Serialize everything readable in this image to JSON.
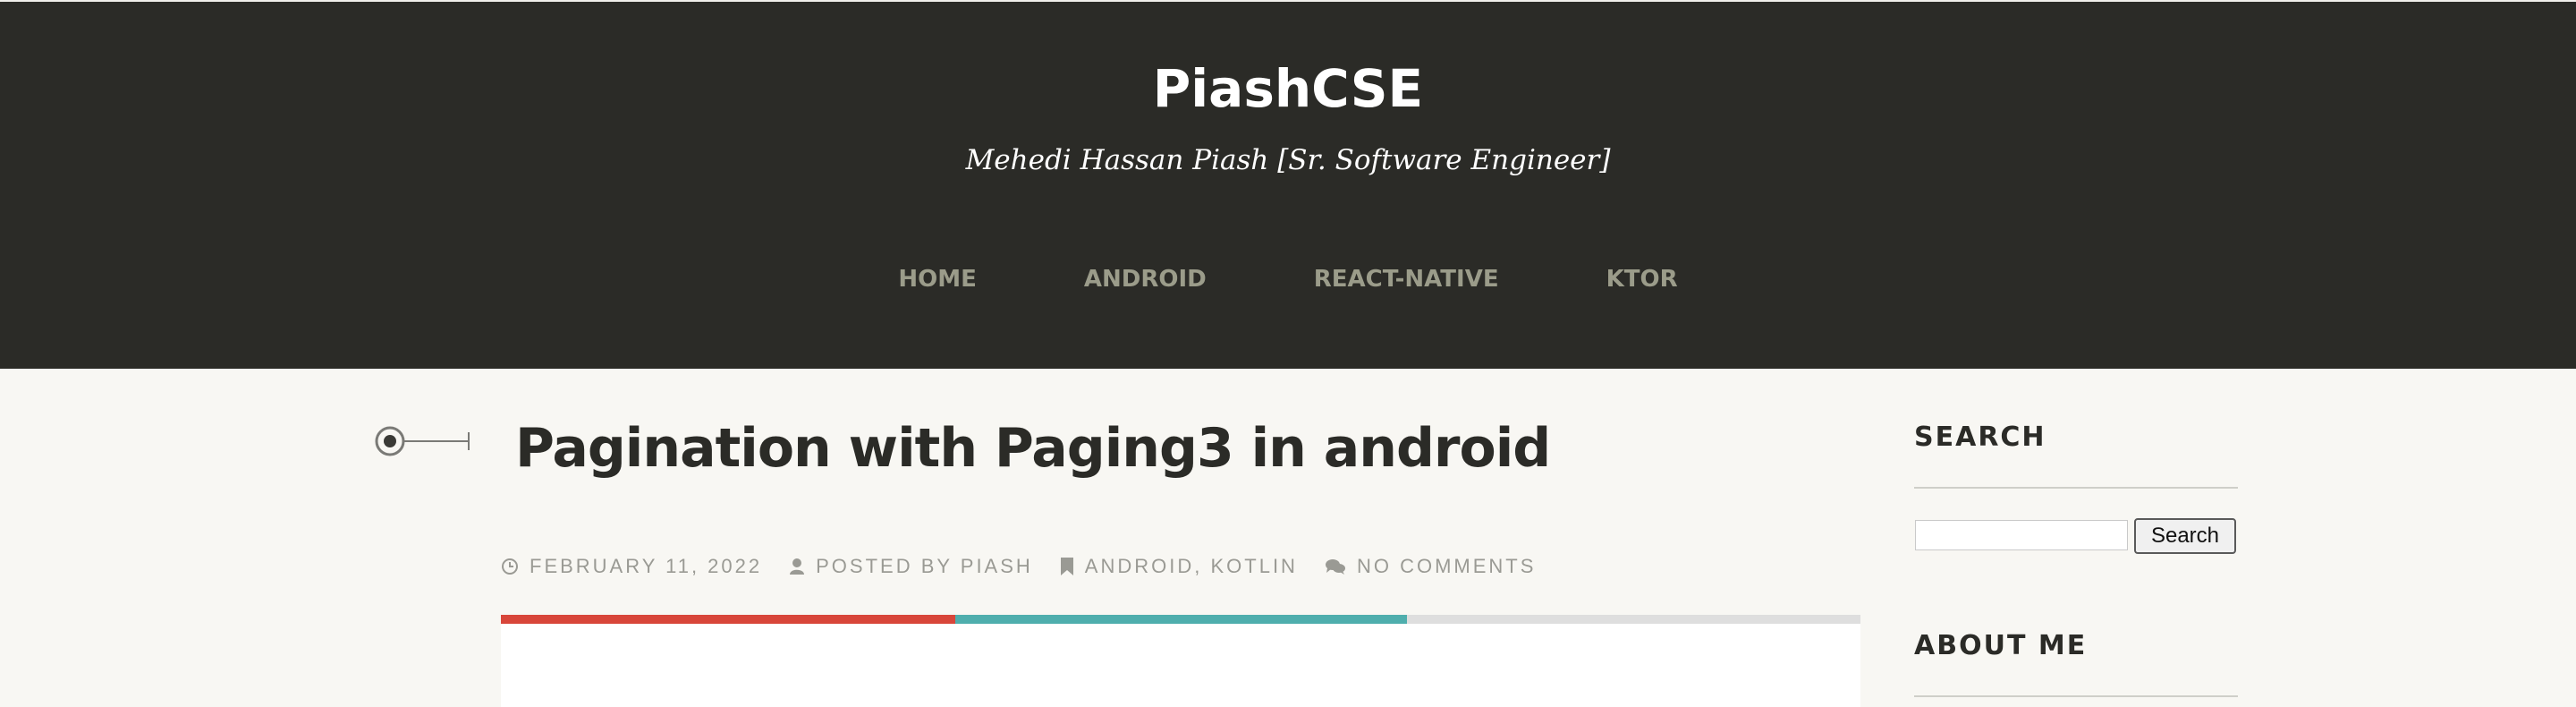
{
  "site": {
    "title": "PiashCSE",
    "subtitle": "Mehedi Hassan Piash [Sr. Software Engineer]"
  },
  "nav": {
    "items": [
      {
        "label": "HOME"
      },
      {
        "label": "ANDROID"
      },
      {
        "label": "REACT-NATIVE"
      },
      {
        "label": "KTOR"
      }
    ]
  },
  "post": {
    "title": "Pagination with Paging3 in android",
    "meta": {
      "date": "FEBRUARY 11, 2022",
      "posted_by_prefix": "POSTED BY ",
      "author": "PIASH",
      "category_1": "ANDROID",
      "category_sep": ", ",
      "category_2": "KOTLIN",
      "comments": "NO COMMENTS"
    },
    "icons": {
      "timeline": "timeline-marker-icon",
      "date": "clock-icon",
      "author": "user-icon",
      "categories": "bookmark-icon",
      "comments": "comments-icon"
    },
    "stripe_colors": [
      "#d8463a",
      "#4faead",
      "#dedede"
    ]
  },
  "sidebar": {
    "search": {
      "title": "SEARCH",
      "input_value": "",
      "button_label": "Search"
    },
    "about": {
      "title": "ABOUT ME"
    }
  },
  "colors": {
    "header_bg": "#2b2b27",
    "page_bg": "#f8f7f3",
    "nav_text": "#9b9c8a",
    "meta_text": "#9a9a94"
  }
}
